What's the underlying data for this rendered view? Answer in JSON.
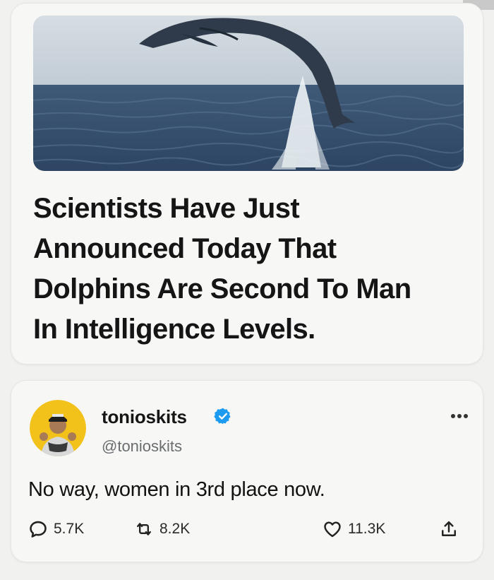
{
  "article": {
    "image_alt_icon": "dolphin-jumping-photo",
    "headline_lines": [
      "Scientists Have Just",
      "Announced Today That",
      "Dolphins Are Second To Man",
      "In Intelligence Levels."
    ]
  },
  "tweet": {
    "display_name": "tonioskits",
    "handle": "@tonioskits",
    "verified": true,
    "text": "No way, women in 3rd place now.",
    "actions": {
      "replies": "5.7K",
      "retweets": "8.2K",
      "likes": "11.3K"
    },
    "colors": {
      "verified_blue": "#1d9bf0",
      "avatar_bg": "#f2c21a"
    }
  }
}
